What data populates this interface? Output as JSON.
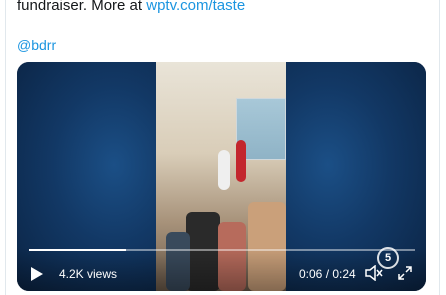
{
  "tweet": {
    "text_prefix": "fundraiser.  More at ",
    "link": "wptv.com/taste",
    "mention": "@bdrr"
  },
  "video": {
    "views": "4.2K views",
    "time": "0:06 / 0:24",
    "progress_fraction": 0.25,
    "logo_mark": "5",
    "colors": {
      "background": "#0d1f3c",
      "progress": "#ffffff"
    }
  },
  "icons": {
    "play": "play-icon",
    "volume": "volume-icon",
    "fullscreen": "fullscreen-icon"
  }
}
